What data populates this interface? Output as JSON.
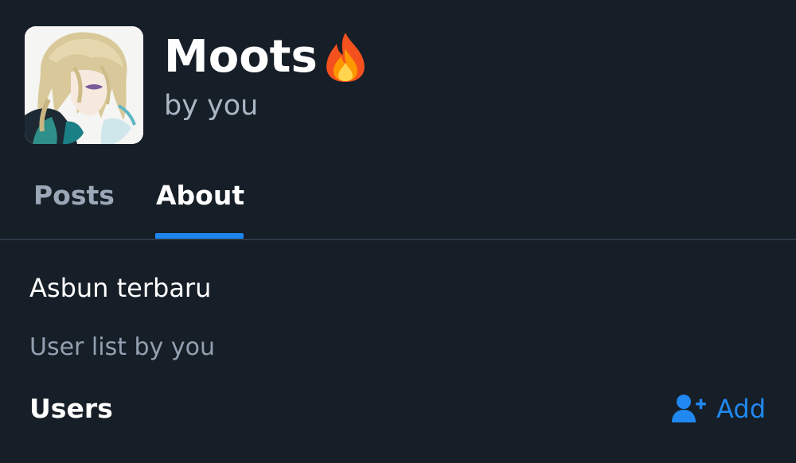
{
  "header": {
    "title": "Moots",
    "title_emoji": "fire-emoji",
    "subtitle": "by you",
    "avatar": "anime-character-avatar"
  },
  "tabs": [
    {
      "label": "Posts",
      "selected": false
    },
    {
      "label": "About",
      "selected": true
    }
  ],
  "about": {
    "description": "Asbun terbaru",
    "list_type_text": "User list by you",
    "users_section": {
      "title": "Users",
      "add_label": "Add",
      "add_icon": "add-user-icon"
    }
  },
  "colors": {
    "background": "#161e27",
    "accent": "#1f86ef",
    "muted_text": "#93a0af"
  }
}
